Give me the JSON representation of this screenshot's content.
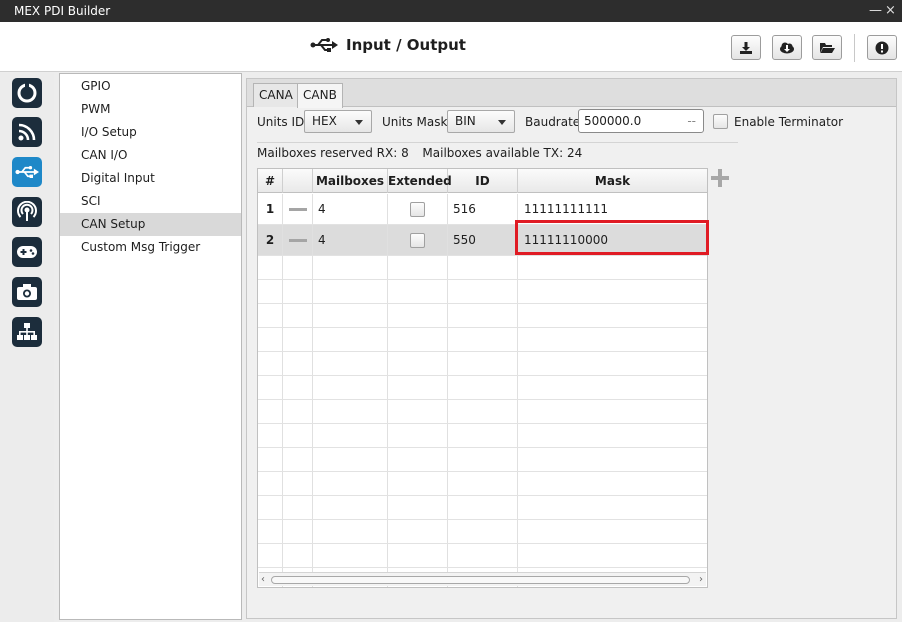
{
  "window": {
    "title": "MEX PDI Builder",
    "minimize_glyph": "—",
    "close_glyph": "×"
  },
  "header": {
    "title": "Input / Output",
    "title_icon": "usb-icon",
    "buttons": [
      "download-icon",
      "cloud-download-icon",
      "folder-open-icon",
      "info-icon"
    ]
  },
  "rail": [
    "power-icon",
    "rss-icon",
    "usb-icon",
    "broadcast-icon",
    "gamepad-icon",
    "camera-icon",
    "sitemap-icon"
  ],
  "menu": {
    "items": [
      "GPIO",
      "PWM",
      "I/O Setup",
      "CAN I/O",
      "Digital Input",
      "SCI",
      "CAN Setup",
      "Custom Msg Trigger"
    ],
    "selected": "CAN Setup"
  },
  "tabs": {
    "items": [
      "CANA",
      "CANB"
    ],
    "active": "CANB"
  },
  "config": {
    "units_id_label": "Units ID",
    "units_id_value": "HEX",
    "units_mask_label": "Units Mask",
    "units_mask_value": "BIN",
    "baudrate_label": "Baudrate",
    "baudrate_value": "500000.0",
    "baudrate_suffix": "--",
    "terminator_label": "Enable Terminator",
    "terminator_checked": false
  },
  "status": {
    "reserved_rx_label": "Mailboxes reserved RX:",
    "reserved_rx_value": "8",
    "available_tx_label": "Mailboxes available TX:",
    "available_tx_value": "24"
  },
  "table": {
    "headers": [
      "#",
      "",
      "Mailboxes",
      "Extended",
      "ID",
      "Mask"
    ],
    "rows": [
      {
        "num": "1",
        "mailboxes": "4",
        "extended": false,
        "id": "516",
        "mask": "11111111111"
      },
      {
        "num": "2",
        "mailboxes": "4",
        "extended": false,
        "id": "550",
        "mask": "11111110000"
      }
    ],
    "selected_row": 2,
    "highlighted_cell": {
      "row": 2,
      "column": "Mask"
    },
    "scroll_left_glyph": "‹",
    "scroll_right_glyph": "›"
  },
  "add_button_glyph": "+",
  "colors": {
    "accent": "#1e88c8",
    "highlight": "#e01b24",
    "rail_icon_bg": "#1c2d3c"
  }
}
